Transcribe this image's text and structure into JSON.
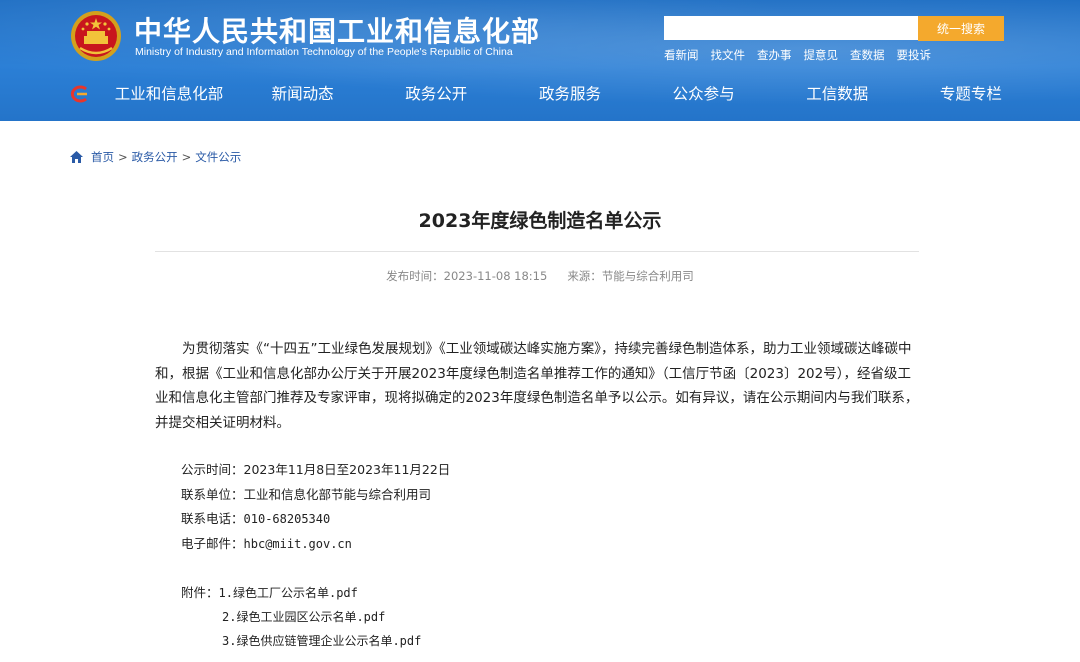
{
  "header": {
    "site_title": "中华人民共和国工业和信息化部",
    "site_subtitle": "Ministry of Industry and Information Technology of the People's Republic of China",
    "search_placeholder": "",
    "search_button": "统一搜索",
    "quicklinks": [
      "看新闻",
      "找文件",
      "查办事",
      "提意见",
      "查数据",
      "要投诉"
    ]
  },
  "nav": {
    "items": [
      "工业和信息化部",
      "新闻动态",
      "政务公开",
      "政务服务",
      "公众参与",
      "工信数据",
      "专题专栏"
    ]
  },
  "breadcrumb": {
    "items": [
      "首页",
      "政务公开",
      "文件公示"
    ],
    "separator": ">"
  },
  "article": {
    "title": "2023年度绿色制造名单公示",
    "publish_label": "发布时间：",
    "publish_time": "2023-11-08 18:15",
    "source_label": "来源：",
    "source": "节能与综合利用司",
    "paragraph": "为贯彻落实《“十四五”工业绿色发展规划》《工业领域碳达峰实施方案》，持续完善绿色制造体系，助力工业领域碳达峰碳中和，根据《工业和信息化部办公厅关于开展2023年度绿色制造名单推荐工作的通知》（工信厅节函〔2023〕202号），经省级工业和信息化主管部门推荐及专家评审，现将拟确定的2023年度绿色制造名单予以公示。如有异议，请在公示期间内与我们联系，并提交相关证明材料。",
    "info": {
      "period_label": "公示时间：",
      "period": "2023年11月8日至2023年11月22日",
      "unit_label": "联系单位：",
      "unit": "工业和信息化部节能与综合利用司",
      "phone_label": "联系电话：",
      "phone": "010-68205340",
      "email_label": "电子邮件：",
      "email": "hbc@miit.gov.cn"
    },
    "attachments_label": "附件：",
    "attachments": [
      "1.绿色工厂公示名单.pdf",
      "2.绿色工业园区公示名单.pdf",
      "3.绿色供应链管理企业公示名单.pdf"
    ]
  },
  "colors": {
    "header_blue": "#2474c9",
    "search_button": "#f4a92d",
    "breadcrumb_link": "#2a5aa6"
  },
  "icons": [
    "national-emblem-icon",
    "nav-logo-icon",
    "home-icon"
  ]
}
